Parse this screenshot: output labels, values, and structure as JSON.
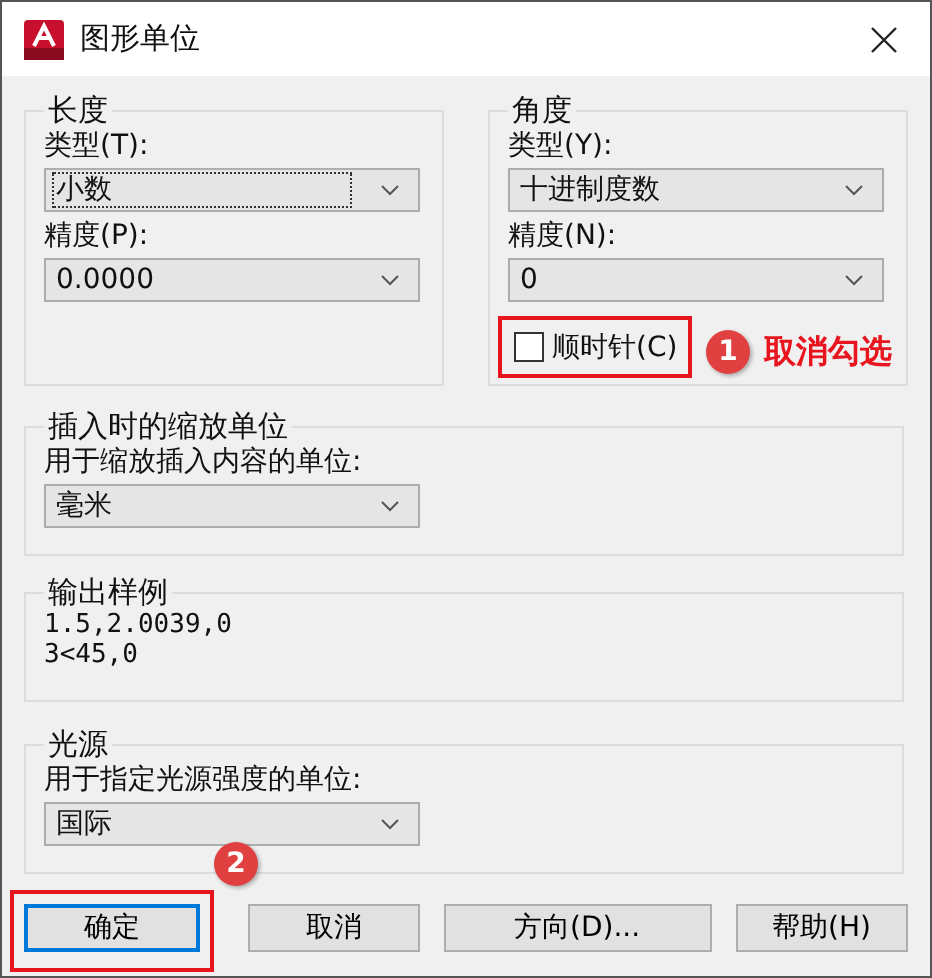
{
  "window": {
    "title": "图形单位"
  },
  "length": {
    "title": "长度",
    "type_label": "类型(T):",
    "type_value": "小数",
    "type_focused": true,
    "precision_label": "精度(P):",
    "precision_value": "0.0000"
  },
  "angle": {
    "title": "角度",
    "type_label": "类型(Y):",
    "type_value": "十进制度数",
    "precision_label": "精度(N):",
    "precision_value": "0",
    "clockwise": {
      "label": "顺时针(C)",
      "checked": false
    }
  },
  "insertion": {
    "title": "插入时的缩放单位",
    "label": "用于缩放插入内容的单位:",
    "value": "毫米"
  },
  "sample": {
    "title": "输出样例",
    "lines": [
      "1.5,2.0039,0",
      "3<45,0"
    ]
  },
  "lighting": {
    "title": "光源",
    "label": "用于指定光源强度的单位:",
    "value": "国际"
  },
  "buttons": [
    {
      "label": "确定",
      "selected": true
    },
    {
      "label": "取消",
      "selected": false
    },
    {
      "label": "方向(D)...",
      "selected": false
    },
    {
      "label": "帮助(H)",
      "selected": false
    }
  ],
  "annotations": [
    {
      "kind": "checkbox",
      "number": "1",
      "text": "取消勾选"
    },
    {
      "kind": "button",
      "number": "2"
    }
  ]
}
